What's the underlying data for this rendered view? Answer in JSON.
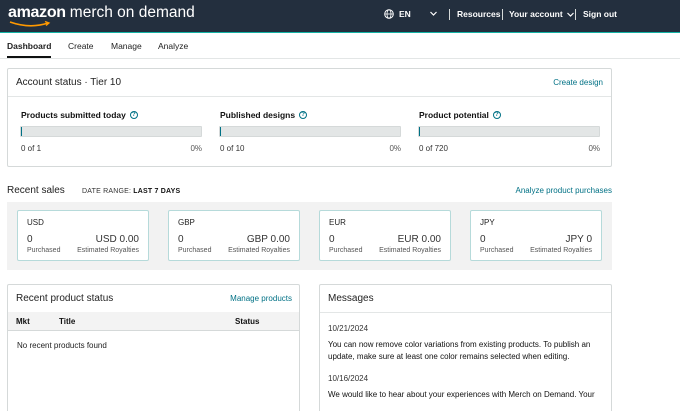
{
  "header": {
    "logo_amazon": "amazon",
    "logo_rest": "merch on demand",
    "language": "EN",
    "resources": "Resources",
    "account": "Your account",
    "signout": "Sign out",
    "bg_color": "#232f3e",
    "accent_line": "#14b3a6"
  },
  "tabs": [
    {
      "label": "Dashboard",
      "active": true
    },
    {
      "label": "Create"
    },
    {
      "label": "Manage"
    },
    {
      "label": "Analyze"
    }
  ],
  "account_status": {
    "title": "Account status · Tier 10",
    "create_link": "Create design",
    "metrics": [
      {
        "label": "Products submitted today",
        "count": "0 of 1",
        "pct": "0%",
        "progress": 0
      },
      {
        "label": "Published designs",
        "count": "0 of 10",
        "pct": "0%",
        "progress": 0
      },
      {
        "label": "Product potential",
        "count": "0 of 720",
        "pct": "0%",
        "progress": 0
      }
    ]
  },
  "recent_sales": {
    "title": "Recent sales",
    "range_label": "DATE RANGE:",
    "range_value": "LAST 7 DAYS",
    "analyze_link": "Analyze product purchases",
    "currencies": [
      {
        "code": "USD",
        "count": "0",
        "amount": "USD 0.00",
        "purchased": "Purchased",
        "royalties": "Estimated Royalties"
      },
      {
        "code": "GBP",
        "count": "0",
        "amount": "GBP 0.00",
        "purchased": "Purchased",
        "royalties": "Estimated Royalties"
      },
      {
        "code": "EUR",
        "count": "0",
        "amount": "EUR 0.00",
        "purchased": "Purchased",
        "royalties": "Estimated Royalties"
      },
      {
        "code": "JPY",
        "count": "0",
        "amount": "JPY 0",
        "purchased": "Purchased",
        "royalties": "Estimated Royalties"
      }
    ]
  },
  "product_status": {
    "title": "Recent product status",
    "manage_link": "Manage products",
    "columns": [
      "Mkt",
      "Title",
      "Status"
    ],
    "empty": "No recent products found"
  },
  "messages": {
    "title": "Messages",
    "items": [
      {
        "date": "10/21/2024",
        "text": "You can now remove color variations from existing products. To publish an update, make sure at least one color remains selected when editing."
      },
      {
        "date": "10/16/2024",
        "text": "We would like to hear about your experiences with Merch on Demand. Your"
      }
    ]
  }
}
